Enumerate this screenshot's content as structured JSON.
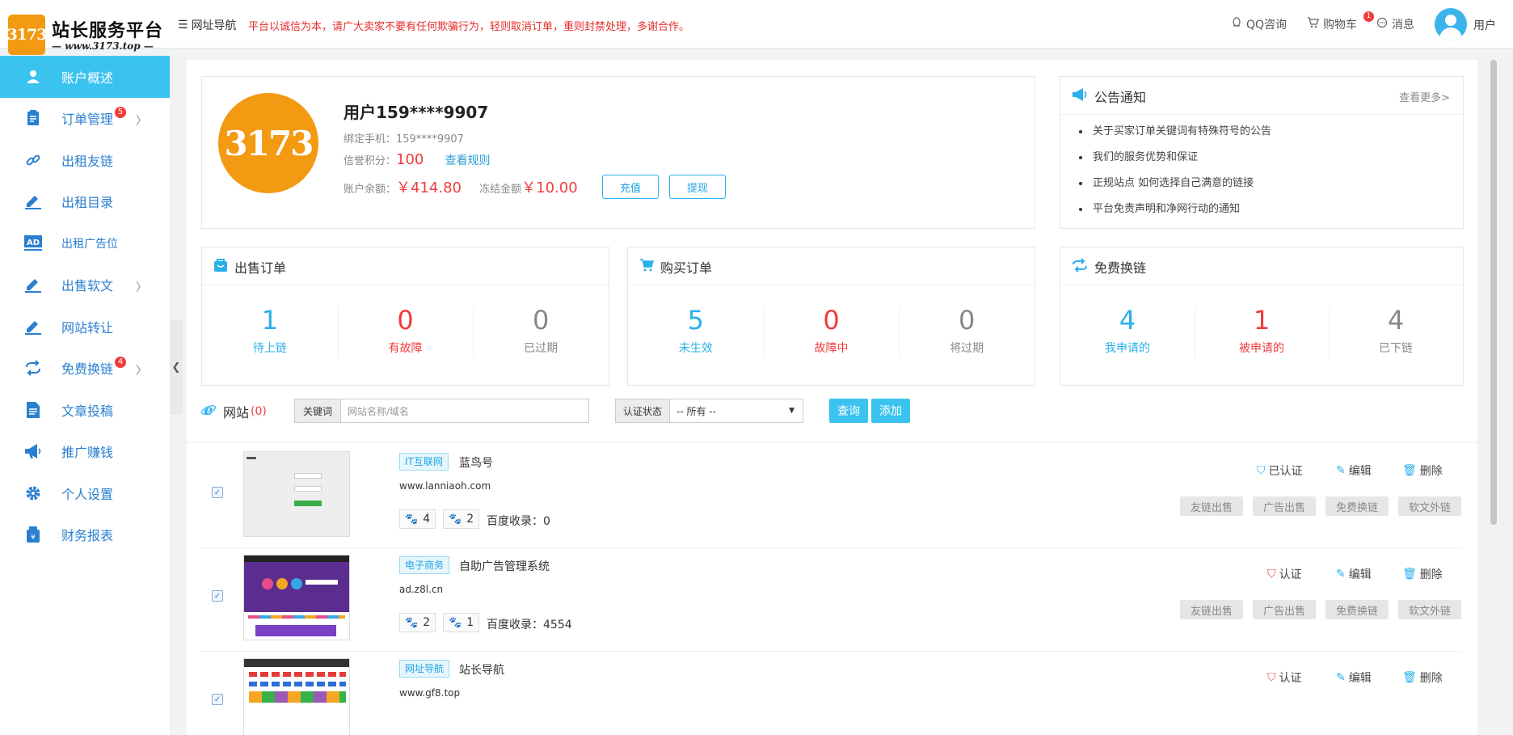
{
  "header": {
    "logo_badge": "3173",
    "logo_title": "站长服务平台",
    "logo_subtitle": "— www.3173.top —",
    "nav_label": "网址导航",
    "notice": "平台以诚信为本，请广大卖家不要有任何欺骗行为，轻则取消订单，重则封禁处理，多谢合作。",
    "qq": "QQ咨询",
    "cart": "购物车",
    "cart_count": "1",
    "messages": "消息",
    "user": "用户"
  },
  "sidebar": {
    "items": [
      {
        "label": "账户概述",
        "icon": "user-icon"
      },
      {
        "label": "订单管理",
        "icon": "clipboard-icon",
        "badge": "5"
      },
      {
        "label": "出租友链",
        "icon": "link-icon"
      },
      {
        "label": "出租目录",
        "icon": "pen-icon"
      },
      {
        "label": "出租广告位",
        "icon": "ad-icon"
      },
      {
        "label": "出售软文",
        "icon": "pen-icon"
      },
      {
        "label": "网站转让",
        "icon": "pen-icon"
      },
      {
        "label": "免费换链",
        "icon": "exchange-icon",
        "badge": "4"
      },
      {
        "label": "文章投稿",
        "icon": "document-icon"
      },
      {
        "label": "推广赚钱",
        "icon": "megaphone-icon"
      },
      {
        "label": "个人设置",
        "icon": "gear-icon"
      },
      {
        "label": "财务报表",
        "icon": "finance-icon"
      }
    ]
  },
  "profile": {
    "avatar": "3173",
    "name": "用户159****9907",
    "phone_label": "绑定手机：",
    "phone": "159****9907",
    "credit_label": "信誉积分：",
    "credit": "100",
    "rules_link": "查看规则",
    "balance_label": "账户余额：",
    "balance": "￥414.80",
    "frozen_label": "冻结金额",
    "frozen": "￥10.00",
    "recharge": "充值",
    "withdraw": "提现"
  },
  "announcements": {
    "title": "公告通知",
    "more": "查看更多>",
    "items": [
      "关于买家订单关键词有特殊符号的公告",
      "我们的服务优势和保证",
      "正规站点 如何选择自己满意的链接",
      "平台免责声明和净网行动的通知"
    ]
  },
  "sell_orders": {
    "title": "出售订单",
    "stats": [
      {
        "value": "1",
        "label": "待上链"
      },
      {
        "value": "0",
        "label": "有故障"
      },
      {
        "value": "0",
        "label": "已过期"
      }
    ]
  },
  "buy_orders": {
    "title": "购买订单",
    "stats": [
      {
        "value": "5",
        "label": "未生效"
      },
      {
        "value": "0",
        "label": "故障中"
      },
      {
        "value": "0",
        "label": "将过期"
      }
    ]
  },
  "free_exchange": {
    "title": "免费换链",
    "stats": [
      {
        "value": "4",
        "label": "我申请的"
      },
      {
        "value": "1",
        "label": "被申请的"
      },
      {
        "value": "4",
        "label": "已下链"
      }
    ]
  },
  "sites": {
    "label": "网站",
    "count": "(0)",
    "keyword_tag": "关键词",
    "keyword_placeholder": "网站名称/域名",
    "status_tag": "认证状态",
    "status_value": "-- 所有 --",
    "query": "查询",
    "add": "添加",
    "edit": "编辑",
    "delete": "删除",
    "baidu_label": "百度收录：",
    "sale_buttons": [
      "友链出售",
      "广告出售",
      "免费换链",
      "软文外链"
    ],
    "rows": [
      {
        "category": "IT互联网",
        "name": "蓝鸟号",
        "url": "www.lanniaoh.com",
        "paw1": "4",
        "paw2": "2",
        "baidu": "0",
        "cert": "已认证",
        "certified": true
      },
      {
        "category": "电子商务",
        "name": "自助广告管理系统",
        "url": "ad.z8l.cn",
        "paw1": "2",
        "paw2": "1",
        "baidu": "4554",
        "cert": "认证",
        "certified": false
      },
      {
        "category": "网址导航",
        "name": "站长导航",
        "url": "www.gf8.top",
        "paw1": "",
        "paw2": "",
        "baidu": "",
        "cert": "认证",
        "certified": false
      }
    ]
  },
  "colors": {
    "accent": "#3bc3f0",
    "brand": "#f39a12",
    "red": "#f03c3c",
    "blue_text": "#2a7fd0"
  }
}
